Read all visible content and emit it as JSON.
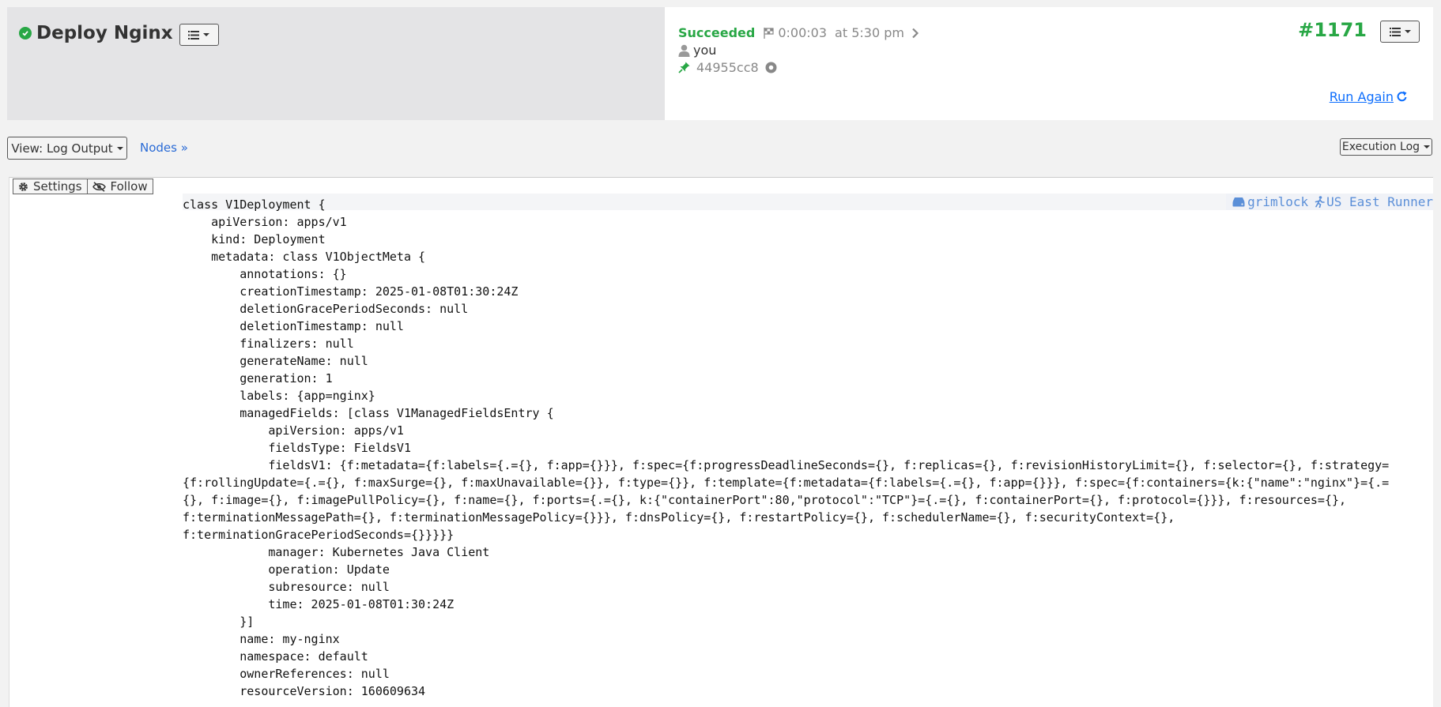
{
  "header": {
    "job_title": "Deploy Nginx",
    "status": "Succeeded",
    "duration": "0:00:03",
    "time": "at 5:30 pm",
    "user": "you",
    "commit": "44955cc8",
    "execution_number": "#1171",
    "run_again_label": "Run Again"
  },
  "toolbar": {
    "view_label": "View: Log Output",
    "nodes_label": "Nodes »",
    "execution_log_label": "Execution Log"
  },
  "log": {
    "settings_label": "Settings",
    "follow_label": "Follow",
    "node_name": "grimlock",
    "runner_name": "US East Runner",
    "lines": "class V1Deployment {\n    apiVersion: apps/v1\n    kind: Deployment\n    metadata: class V1ObjectMeta {\n        annotations: {}\n        creationTimestamp: 2025-01-08T01:30:24Z\n        deletionGracePeriodSeconds: null\n        deletionTimestamp: null\n        finalizers: null\n        generateName: null\n        generation: 1\n        labels: {app=nginx}\n        managedFields: [class V1ManagedFieldsEntry {\n            apiVersion: apps/v1\n            fieldsType: FieldsV1\n            fieldsV1: {f:metadata={f:labels={.={}, f:app={}}}, f:spec={f:progressDeadlineSeconds={}, f:replicas={}, f:revisionHistoryLimit={}, f:selector={}, f:strategy=\n{f:rollingUpdate={.={}, f:maxSurge={}, f:maxUnavailable={}}, f:type={}}, f:template={f:metadata={f:labels={.={}, f:app={}}}, f:spec={f:containers={k:{\"name\":\"nginx\"}={.=\n{}, f:image={}, f:imagePullPolicy={}, f:name={}, f:ports={.={}, k:{\"containerPort\":80,\"protocol\":\"TCP\"}={.={}, f:containerPort={}, f:protocol={}}}, f:resources={},\nf:terminationMessagePath={}, f:terminationMessagePolicy={}}}, f:dnsPolicy={}, f:restartPolicy={}, f:schedulerName={}, f:securityContext={},\nf:terminationGracePeriodSeconds={}}}}}\n            manager: Kubernetes Java Client\n            operation: Update\n            subresource: null\n            time: 2025-01-08T01:30:24Z\n        }]\n        name: my-nginx\n        namespace: default\n        ownerReferences: null\n        resourceVersion: 160609634"
  },
  "colors": {
    "success": "#28a745",
    "link": "#0d6efd",
    "node_tag": "#5b8fd8"
  }
}
